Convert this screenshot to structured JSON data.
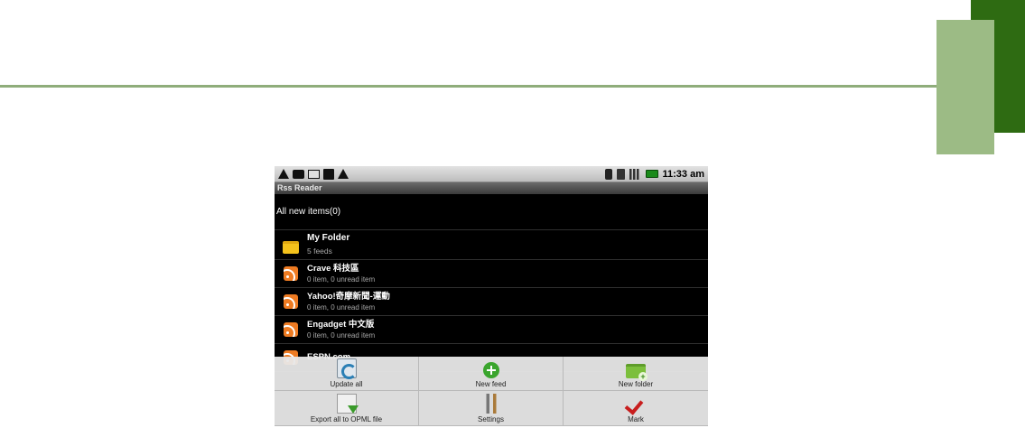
{
  "status_bar": {
    "time": "11:33 am",
    "left_icons": [
      "warning-icon",
      "chat-icon",
      "mail-icon",
      "usb-icon",
      "warning-icon"
    ],
    "right_icons": [
      "bluetooth-icon",
      "wifi-icon",
      "signal-icon",
      "battery-icon"
    ]
  },
  "app": {
    "title": "Rss Reader"
  },
  "all_new": {
    "label": "All new items(0)"
  },
  "folder": {
    "name": "My Folder",
    "subtitle": "5 feeds"
  },
  "feeds": [
    {
      "title": "Crave 科技區",
      "subtitle": "0 item, 0 unread item"
    },
    {
      "title": "Yahoo!奇摩新聞-運動",
      "subtitle": "0 item, 0 unread item"
    },
    {
      "title": "Engadget 中文版",
      "subtitle": "0 item, 0 unread item"
    },
    {
      "title": "ESPN.com",
      "subtitle": ""
    }
  ],
  "menu": {
    "update_all": "Update all",
    "new_feed": "New feed",
    "new_folder": "New folder",
    "export_opml": "Export all to OPML file",
    "settings": "Settings",
    "mark": "Mark"
  },
  "colors": {
    "deco_dark_green": "#2e6b12",
    "deco_light_green": "#9cbb85",
    "rss_orange": "#ee7b22"
  }
}
